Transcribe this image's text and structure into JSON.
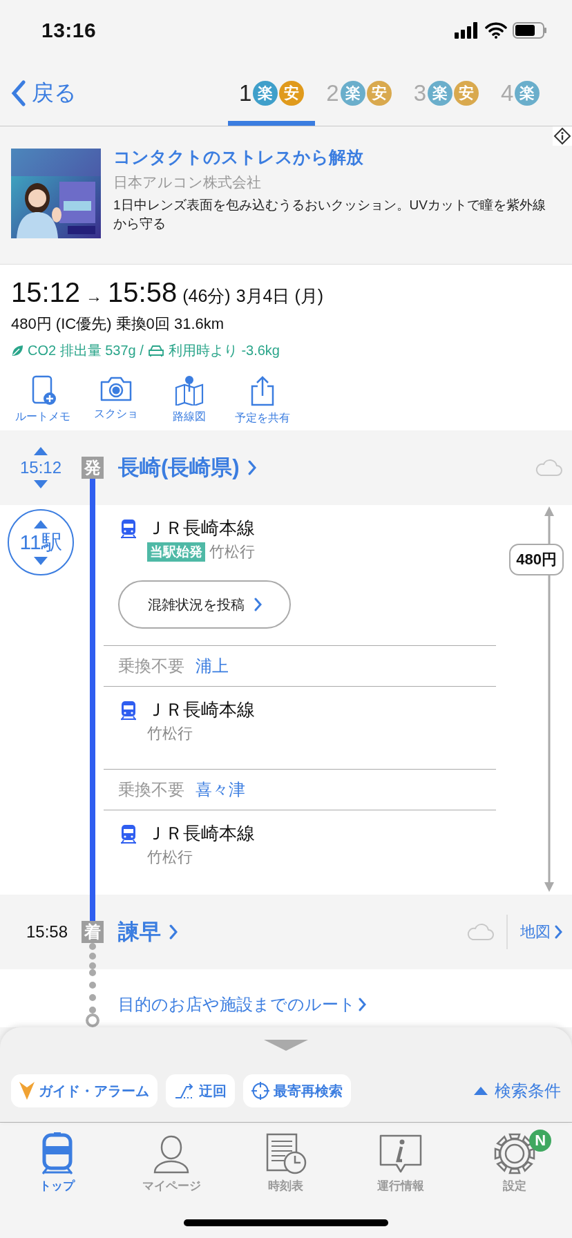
{
  "status_bar": {
    "time": "13:16"
  },
  "nav": {
    "back": "戻る",
    "tabs": [
      {
        "number": "1",
        "badges": [
          "楽",
          "安"
        ],
        "selected": true
      },
      {
        "number": "2",
        "badges": [
          "楽",
          "安"
        ],
        "selected": false
      },
      {
        "number": "3",
        "badges": [
          "楽",
          "安"
        ],
        "selected": false
      },
      {
        "number": "4",
        "badges": [
          "楽"
        ],
        "selected": false
      }
    ]
  },
  "ad": {
    "title": "コンタクトのストレスから解放",
    "advertiser": "日本アルコン株式会社",
    "description": "1日中レンズ表面を包み込むうるおいクッション。UVカットで瞳を紫外線から守る"
  },
  "summary": {
    "departure": "15:12",
    "arrow": "→",
    "arrival": "15:58",
    "duration": "(46分)",
    "date": "3月4日 (月)",
    "fare_line": "480円 (IC優先) 乗換0回 31.6km",
    "co2": "CO2 排出量 537g /",
    "car_saving": "利用時より -3.6kg",
    "actions": [
      {
        "kind": "memo",
        "label": "ルートメモ"
      },
      {
        "kind": "camera",
        "label": "スクショ"
      },
      {
        "kind": "map",
        "label": "路線図"
      },
      {
        "kind": "share",
        "label": "予定を共有"
      }
    ]
  },
  "departure": {
    "time": "15:12",
    "badge": "発",
    "station": "長崎(長崎県)"
  },
  "stops": "11駅",
  "fare": "480円",
  "segments": [
    {
      "kind": "train",
      "line": "ＪＲ長崎本線",
      "tag": "当駅始発",
      "destination": "竹松行",
      "button": "混雑状況を投稿"
    },
    {
      "kind": "pass",
      "label": "乗換不要",
      "station": "浦上"
    },
    {
      "kind": "train",
      "line": "ＪＲ長崎本線",
      "destination": "竹松行"
    },
    {
      "kind": "pass",
      "label": "乗換不要",
      "station": "喜々津"
    },
    {
      "kind": "train",
      "line": "ＪＲ長崎本線",
      "destination": "竹松行"
    }
  ],
  "arrival": {
    "time": "15:58",
    "badge": "着",
    "station": "諫早",
    "map": "地図"
  },
  "destination_link": "目的のお店や施設までのルート",
  "toolbar": {
    "buttons": [
      {
        "kind": "alarm",
        "label": "ガイド・アラーム"
      },
      {
        "kind": "detour",
        "label": "迂回"
      },
      {
        "kind": "nearest",
        "label": "最寄再検索"
      }
    ],
    "conditions": "検索条件"
  },
  "tab_bar": [
    {
      "kind": "top",
      "label": "トップ",
      "selected": true
    },
    {
      "kind": "mypage",
      "label": "マイページ",
      "selected": false
    },
    {
      "kind": "timetable",
      "label": "時刻表",
      "selected": false
    },
    {
      "kind": "info",
      "label": "運行情報",
      "selected": false
    },
    {
      "kind": "settings",
      "label": "設定",
      "selected": false,
      "badge": "N"
    }
  ]
}
